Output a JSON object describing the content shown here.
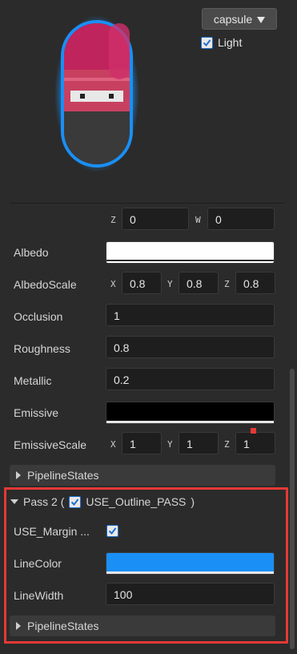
{
  "preview": {
    "shape_select": {
      "value": "capsule",
      "icon": "triangle-down-icon"
    },
    "light": {
      "label": "Light",
      "checked": true
    }
  },
  "vector_row": {
    "z_label": "Z",
    "z_value": "0",
    "w_label": "W",
    "w_value": "0"
  },
  "properties": {
    "albedo": {
      "label": "Albedo",
      "color": "#ffffff"
    },
    "albedo_scale": {
      "label": "AlbedoScale",
      "x_label": "X",
      "x": "0.8",
      "y_label": "Y",
      "y": "0.8",
      "z_label": "Z",
      "z": "0.8"
    },
    "occlusion": {
      "label": "Occlusion",
      "value": "1"
    },
    "roughness": {
      "label": "Roughness",
      "value": "0.8"
    },
    "metallic": {
      "label": "Metallic",
      "value": "0.2"
    },
    "emissive": {
      "label": "Emissive",
      "color": "#000000"
    },
    "emissive_scale": {
      "label": "EmissiveScale",
      "x_label": "X",
      "x": "1",
      "y_label": "Y",
      "y": "1",
      "z_label": "Z",
      "z": "1"
    },
    "pipeline_states": {
      "label": "PipelineStates"
    }
  },
  "pass2": {
    "title_prefix": "Pass 2 (",
    "define_name": "USE_Outline_PASS",
    "title_suffix": ")",
    "enabled": true,
    "use_margin": {
      "label": "USE_Margin ...",
      "checked": true
    },
    "line_color": {
      "label": "LineColor",
      "color": "#1a8ff5"
    },
    "line_width": {
      "label": "LineWidth",
      "value": "100"
    },
    "pipeline_states": {
      "label": "PipelineStates"
    }
  }
}
